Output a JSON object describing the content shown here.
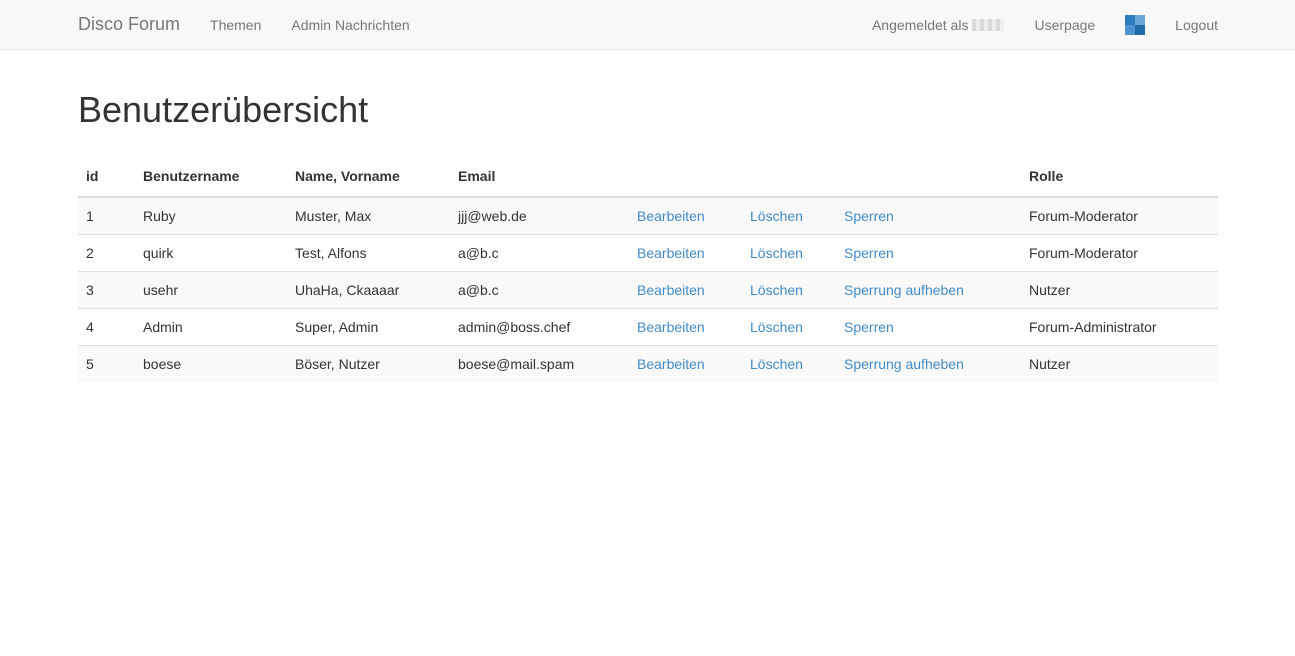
{
  "navbar": {
    "brand": "Disco Forum",
    "links": [
      "Themen",
      "Admin Nachrichten"
    ],
    "logged_in_label": "Angemeldet als",
    "userpage": "Userpage",
    "logout": "Logout"
  },
  "page": {
    "title": "Benutzerübersicht"
  },
  "table": {
    "headers": {
      "id": "id",
      "username": "Benutzername",
      "name": "Name, Vorname",
      "email": "Email",
      "role": "Rolle"
    },
    "rows": [
      {
        "id": "1",
        "username": "Ruby",
        "name": "Muster, Max",
        "email": "jjj@web.de",
        "edit": "Bearbeiten",
        "delete": "Löschen",
        "block": "Sperren",
        "role": "Forum-Moderator"
      },
      {
        "id": "2",
        "username": "quirk",
        "name": "Test, Alfons",
        "email": "a@b.c",
        "edit": "Bearbeiten",
        "delete": "Löschen",
        "block": "Sperren",
        "role": "Forum-Moderator"
      },
      {
        "id": "3",
        "username": "usehr",
        "name": "UhaHa, Ckaaaar",
        "email": "a@b.c",
        "edit": "Bearbeiten",
        "delete": "Löschen",
        "block": "Sperrung aufheben",
        "role": "Nutzer"
      },
      {
        "id": "4",
        "username": "Admin",
        "name": "Super, Admin",
        "email": "admin@boss.chef",
        "edit": "Bearbeiten",
        "delete": "Löschen",
        "block": "Sperren",
        "role": "Forum-Administrator"
      },
      {
        "id": "5",
        "username": "boese",
        "name": "Böser, Nutzer",
        "email": "boese@mail.spam",
        "edit": "Bearbeiten",
        "delete": "Löschen",
        "block": "Sperrung aufheben",
        "role": "Nutzer"
      }
    ]
  },
  "colors": {
    "link": "#428bca",
    "navbar_bg": "#f8f8f8",
    "nav_text": "#777777",
    "stripe": "#f9f9f9"
  },
  "icons": {
    "avatar": "user-avatar-icon"
  }
}
